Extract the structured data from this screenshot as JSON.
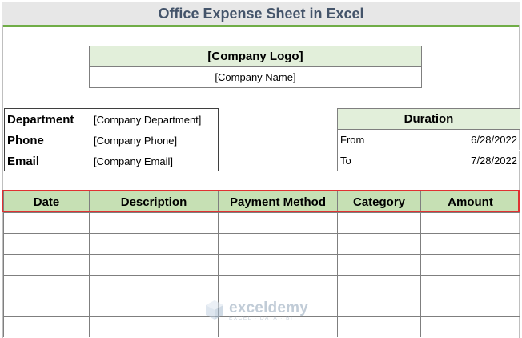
{
  "title": "Office Expense Sheet in Excel",
  "company": {
    "logo": "[Company Logo]",
    "name": "[Company Name]"
  },
  "info": [
    {
      "label": "Department",
      "value": "[Company Department]"
    },
    {
      "label": "Phone",
      "value": "[Company Phone]"
    },
    {
      "label": "Email",
      "value": "[Company Email]"
    }
  ],
  "duration": {
    "heading": "Duration",
    "from_label": "From",
    "from_value": "6/28/2022",
    "to_label": "To",
    "to_value": "7/28/2022"
  },
  "table": {
    "columns": [
      "Date",
      "Description",
      "Payment Method",
      "Category",
      "Amount"
    ],
    "rows": [
      [
        "",
        "",
        "",
        "",
        ""
      ],
      [
        "",
        "",
        "",
        "",
        ""
      ],
      [
        "",
        "",
        "",
        "",
        ""
      ],
      [
        "",
        "",
        "",
        "",
        ""
      ],
      [
        "",
        "",
        "",
        "",
        ""
      ],
      [
        "",
        "",
        "",
        "",
        ""
      ]
    ]
  },
  "watermark": {
    "name": "exceldemy",
    "tagline": "EXCEL · DATA · BI"
  },
  "colors": {
    "title_text": "#44546a",
    "accent_green": "#70ad47",
    "header_fill": "#c6e0b4",
    "light_fill": "#e2efda",
    "highlight": "#e03232"
  }
}
